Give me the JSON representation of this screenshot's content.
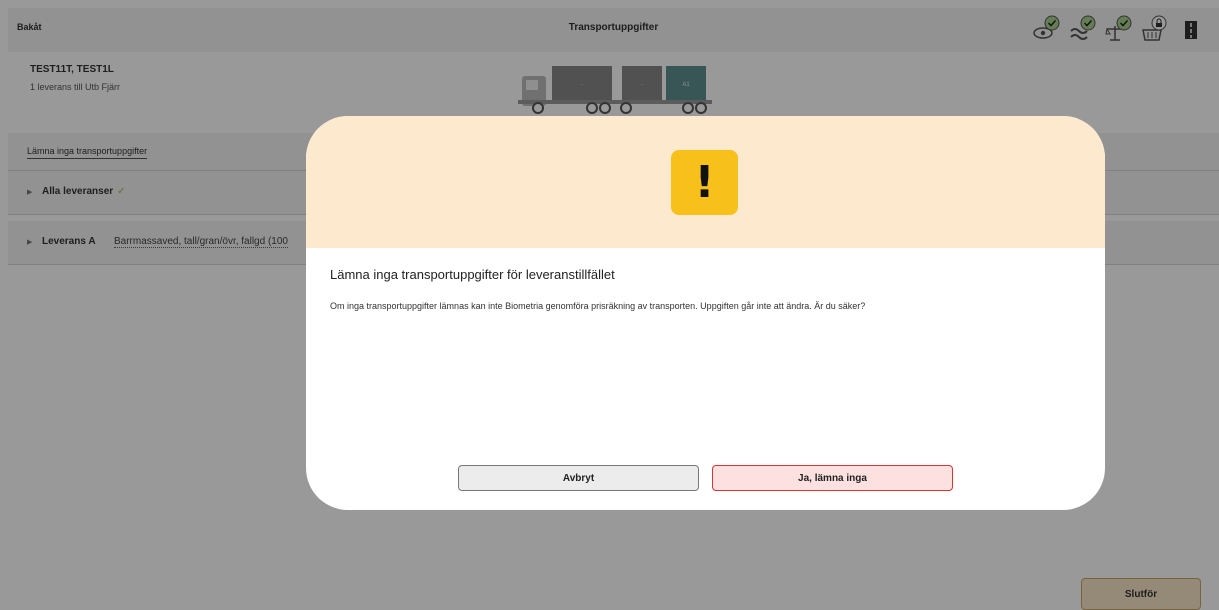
{
  "header": {
    "back_label": "Bakåt",
    "title": "Transportuppgifter"
  },
  "status_icons": [
    "eye-check-icon",
    "waves-check-icon",
    "scale-check-icon",
    "basket-lock-icon",
    "road-icon"
  ],
  "vehicle": {
    "registration": "TEST11T, TEST1L",
    "delivery_summary": "1 leverans till Utb Fjärr",
    "compartments": [
      "-",
      "-",
      "A1"
    ]
  },
  "rows": {
    "no_data_link": "Lämna inga transportuppgifter",
    "all_deliveries_label": "Alla leveranser",
    "delivery_label": "Leverans A",
    "delivery_desc": "Barrmassaved, tall/gran/övr, fallgd (100"
  },
  "footer": {
    "finish_label": "Slutför"
  },
  "modal": {
    "title": "Lämna inga transportuppgifter för leveranstillfället",
    "text": "Om inga transportuppgifter lämnas kan inte Biometria genomföra prisräkning av transporten. Uppgiften går inte att ändra. Är du säker?",
    "cancel_label": "Avbryt",
    "confirm_label": "Ja, lämna inga",
    "warning_glyph": "!"
  },
  "colors": {
    "warning_bg": "#fde9cd",
    "warning_icon": "#f7c01a",
    "confirm_border": "#dd3333",
    "check": "#8bc34a"
  }
}
